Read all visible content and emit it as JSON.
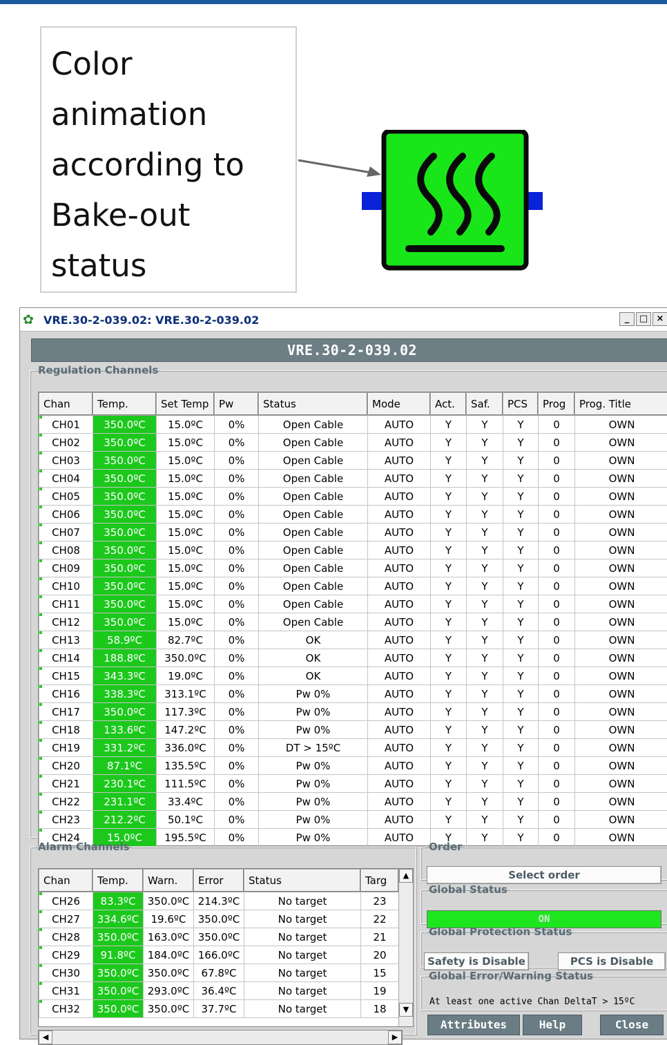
{
  "annotation": {
    "text_lines": [
      "Color",
      "animation",
      "according to",
      "Bake-out",
      "status"
    ],
    "heater_icon": "heater-icon",
    "colors": {
      "heater_fill": "#19e619",
      "connector": "#0a22d8"
    }
  },
  "window": {
    "title": "VRE.30-2-039.02: VRE.30-2-039.02",
    "app_icon": "gear-icon",
    "minimize": "_",
    "maximize": "□",
    "close": "×",
    "banner": "VRE.30-2-039.02"
  },
  "regulation": {
    "legend": "Regulation Channels",
    "columns": [
      "Chan",
      "Temp.",
      "Set Temp",
      "Pw",
      "Status",
      "Mode",
      "Act.",
      "Saf.",
      "PCS",
      "Prog",
      "Prog. Title"
    ],
    "rows": [
      [
        "CH01",
        "350.0ºC",
        "15.0ºC",
        "0%",
        "Open Cable",
        "AUTO",
        "Y",
        "Y",
        "Y",
        "0",
        "OWN"
      ],
      [
        "CH02",
        "350.0ºC",
        "15.0ºC",
        "0%",
        "Open Cable",
        "AUTO",
        "Y",
        "Y",
        "Y",
        "0",
        "OWN"
      ],
      [
        "CH03",
        "350.0ºC",
        "15.0ºC",
        "0%",
        "Open Cable",
        "AUTO",
        "Y",
        "Y",
        "Y",
        "0",
        "OWN"
      ],
      [
        "CH04",
        "350.0ºC",
        "15.0ºC",
        "0%",
        "Open Cable",
        "AUTO",
        "Y",
        "Y",
        "Y",
        "0",
        "OWN"
      ],
      [
        "CH05",
        "350.0ºC",
        "15.0ºC",
        "0%",
        "Open Cable",
        "AUTO",
        "Y",
        "Y",
        "Y",
        "0",
        "OWN"
      ],
      [
        "CH06",
        "350.0ºC",
        "15.0ºC",
        "0%",
        "Open Cable",
        "AUTO",
        "Y",
        "Y",
        "Y",
        "0",
        "OWN"
      ],
      [
        "CH07",
        "350.0ºC",
        "15.0ºC",
        "0%",
        "Open Cable",
        "AUTO",
        "Y",
        "Y",
        "Y",
        "0",
        "OWN"
      ],
      [
        "CH08",
        "350.0ºC",
        "15.0ºC",
        "0%",
        "Open Cable",
        "AUTO",
        "Y",
        "Y",
        "Y",
        "0",
        "OWN"
      ],
      [
        "CH09",
        "350.0ºC",
        "15.0ºC",
        "0%",
        "Open Cable",
        "AUTO",
        "Y",
        "Y",
        "Y",
        "0",
        "OWN"
      ],
      [
        "CH10",
        "350.0ºC",
        "15.0ºC",
        "0%",
        "Open Cable",
        "AUTO",
        "Y",
        "Y",
        "Y",
        "0",
        "OWN"
      ],
      [
        "CH11",
        "350.0ºC",
        "15.0ºC",
        "0%",
        "Open Cable",
        "AUTO",
        "Y",
        "Y",
        "Y",
        "0",
        "OWN"
      ],
      [
        "CH12",
        "350.0ºC",
        "15.0ºC",
        "0%",
        "Open Cable",
        "AUTO",
        "Y",
        "Y",
        "Y",
        "0",
        "OWN"
      ],
      [
        "CH13",
        "58.9ºC",
        "82.7ºC",
        "0%",
        "OK",
        "AUTO",
        "Y",
        "Y",
        "Y",
        "0",
        "OWN"
      ],
      [
        "CH14",
        "188.8ºC",
        "350.0ºC",
        "0%",
        "OK",
        "AUTO",
        "Y",
        "Y",
        "Y",
        "0",
        "OWN"
      ],
      [
        "CH15",
        "343.3ºC",
        "19.0ºC",
        "0%",
        "OK",
        "AUTO",
        "Y",
        "Y",
        "Y",
        "0",
        "OWN"
      ],
      [
        "CH16",
        "338.3ºC",
        "313.1ºC",
        "0%",
        "Pw 0%",
        "AUTO",
        "Y",
        "Y",
        "Y",
        "0",
        "OWN"
      ],
      [
        "CH17",
        "350.0ºC",
        "117.3ºC",
        "0%",
        "Pw 0%",
        "AUTO",
        "Y",
        "Y",
        "Y",
        "0",
        "OWN"
      ],
      [
        "CH18",
        "133.6ºC",
        "147.2ºC",
        "0%",
        "Pw 0%",
        "AUTO",
        "Y",
        "Y",
        "Y",
        "0",
        "OWN"
      ],
      [
        "CH19",
        "331.2ºC",
        "336.0ºC",
        "0%",
        "DT > 15ºC",
        "AUTO",
        "Y",
        "Y",
        "Y",
        "0",
        "OWN"
      ],
      [
        "CH20",
        "87.1ºC",
        "135.5ºC",
        "0%",
        "Pw 0%",
        "AUTO",
        "Y",
        "Y",
        "Y",
        "0",
        "OWN"
      ],
      [
        "CH21",
        "230.1ºC",
        "111.5ºC",
        "0%",
        "Pw 0%",
        "AUTO",
        "Y",
        "Y",
        "Y",
        "0",
        "OWN"
      ],
      [
        "CH22",
        "231.1ºC",
        "33.4ºC",
        "0%",
        "Pw 0%",
        "AUTO",
        "Y",
        "Y",
        "Y",
        "0",
        "OWN"
      ],
      [
        "CH23",
        "212.2ºC",
        "50.1ºC",
        "0%",
        "Pw 0%",
        "AUTO",
        "Y",
        "Y",
        "Y",
        "0",
        "OWN"
      ],
      [
        "CH24",
        "15.0ºC",
        "195.5ºC",
        "0%",
        "Pw 0%",
        "AUTO",
        "Y",
        "Y",
        "Y",
        "0",
        "OWN"
      ]
    ]
  },
  "alarm": {
    "legend": "Alarm Channels",
    "columns": [
      "Chan",
      "Temp.",
      "Warn.",
      "Error",
      "Status",
      "Targ"
    ],
    "rows": [
      [
        "CH26",
        "83.3ºC",
        "350.0ºC",
        "214.3ºC",
        "No target",
        "23"
      ],
      [
        "CH27",
        "334.6ºC",
        "19.6ºC",
        "350.0ºC",
        "No target",
        "22"
      ],
      [
        "CH28",
        "350.0ºC",
        "163.0ºC",
        "350.0ºC",
        "No target",
        "21"
      ],
      [
        "CH29",
        "91.8ºC",
        "184.0ºC",
        "166.0ºC",
        "No target",
        "20"
      ],
      [
        "CH30",
        "350.0ºC",
        "350.0ºC",
        "67.8ºC",
        "No target",
        "15"
      ],
      [
        "CH31",
        "350.0ºC",
        "293.0ºC",
        "36.4ºC",
        "No target",
        "19"
      ],
      [
        "CH32",
        "350.0ºC",
        "350.0ºC",
        "37.7ºC",
        "No target",
        "18"
      ]
    ],
    "scroll_up": "▲",
    "scroll_down": "▼",
    "scroll_left": "◀",
    "scroll_right": "▶"
  },
  "order": {
    "legend": "Order",
    "select_label": "Select order"
  },
  "global_status": {
    "legend": "Global Status",
    "value": "ON",
    "color": "#1ee61e"
  },
  "global_protection": {
    "legend": "Global Protection Status",
    "safety": "Safety is Disable",
    "pcs": "PCS is Disable"
  },
  "global_error": {
    "legend": "Global Error/Warning Status",
    "message": "At least one active Chan DeltaT > 15ºC"
  },
  "buttons": {
    "attributes": "Attributes",
    "help": "Help",
    "close": "Close"
  },
  "colors": {
    "temp_cell": "#1cc81c",
    "banner": "#6d7e85",
    "title_text": "#0c2f7a"
  }
}
